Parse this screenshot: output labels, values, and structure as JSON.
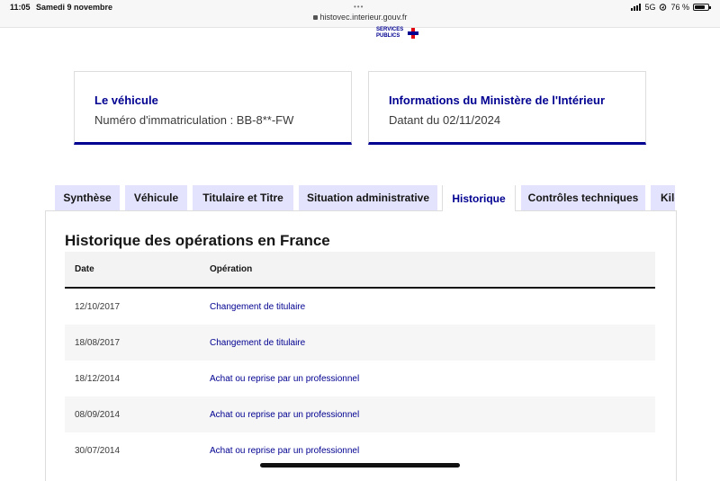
{
  "status_bar": {
    "time": "11:05",
    "date": "Samedi 9 novembre",
    "url": "histovec.interieur.gouv.fr",
    "network": "5G",
    "battery": "76 %"
  },
  "logo": {
    "line1": "SERVICES",
    "line2": "PUBLICS"
  },
  "vehicle_card": {
    "title": "Le véhicule",
    "text": "Numéro d'immatriculation : BB-8**-FW"
  },
  "ministry_card": {
    "title": "Informations du Ministère de l'Intérieur",
    "text": "Datant du 02/11/2024"
  },
  "tabs": [
    {
      "label": "Synthèse"
    },
    {
      "label": "Véhicule"
    },
    {
      "label": "Titulaire et Titre"
    },
    {
      "label": "Situation administrative"
    },
    {
      "label": "Historique"
    },
    {
      "label": "Contrôles techniques"
    },
    {
      "label": "Kilo"
    }
  ],
  "history": {
    "title": "Historique des opérations en France",
    "columns": {
      "date": "Date",
      "operation": "Opération"
    },
    "rows": [
      {
        "date": "12/10/2017",
        "operation": "Changement de titulaire"
      },
      {
        "date": "18/08/2017",
        "operation": "Changement de titulaire"
      },
      {
        "date": "18/12/2014",
        "operation": "Achat ou reprise par un professionnel"
      },
      {
        "date": "08/09/2014",
        "operation": "Achat ou reprise par un professionnel"
      },
      {
        "date": "30/07/2014",
        "operation": "Achat ou reprise par un professionnel"
      }
    ]
  },
  "colors": {
    "brand_blue": "#000091",
    "tab_bg": "#e3e3fd",
    "marianne_red": "#e1000f"
  }
}
